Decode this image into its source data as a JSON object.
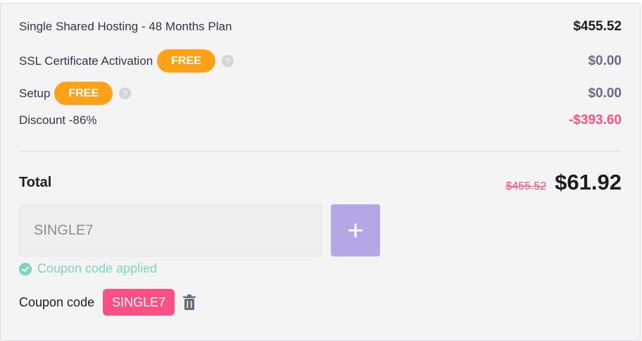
{
  "items": [
    {
      "label": "Single Shared Hosting - 48 Months Plan",
      "amount": "$455.52",
      "badge": null,
      "help": false
    },
    {
      "label": "SSL Certificate Activation",
      "amount": "$0.00",
      "badge": "FREE",
      "help": true
    },
    {
      "label": "Setup",
      "amount": "$0.00",
      "badge": "FREE",
      "help": true
    },
    {
      "label": "Discount -86%",
      "amount": "-$393.60",
      "badge": null,
      "help": false
    }
  ],
  "help_glyph": "?",
  "total": {
    "label": "Total",
    "old_price": "$455.52",
    "new_price": "$61.92"
  },
  "coupon": {
    "input_value": "SINGLE7",
    "applied_message": "Coupon code applied",
    "label": "Coupon code",
    "code": "SINGLE7"
  },
  "icons": {
    "help": "question-circle-icon",
    "add": "plus-icon",
    "applied": "check-circle-icon",
    "remove": "trash-icon"
  },
  "colors": {
    "free_badge": "#ffa21a",
    "discount": "#fc5185",
    "add_button": "#b5a6e6",
    "applied": "#7fd3c1",
    "coupon_chip": "#fc5185"
  }
}
